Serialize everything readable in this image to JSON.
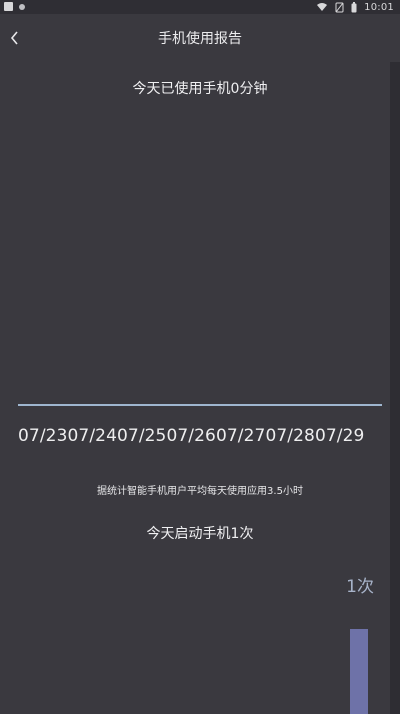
{
  "status_bar": {
    "time": "10:01",
    "icons": [
      "notification-icon",
      "app-icon",
      "wifi-icon",
      "no-sim-icon",
      "battery-icon"
    ]
  },
  "header": {
    "title": "手机使用报告",
    "back_icon": "chevron-left-icon"
  },
  "usage": {
    "today_text": "今天已使用手机0分钟"
  },
  "timeline": {
    "dates_text": "07/2307/2407/2507/2607/2707/2807/29"
  },
  "stats": {
    "average_note": "据统计智能手机用户平均每天使用应用3.5小时",
    "unlock_text": "今天启动手机1次",
    "bar_label": "1次",
    "bar_fraction": 0.55
  },
  "colors": {
    "background": "#3a393f",
    "baseline": "#9fb6cf",
    "bar": "#6e72a8",
    "bar_label": "#a7b3c9"
  }
}
